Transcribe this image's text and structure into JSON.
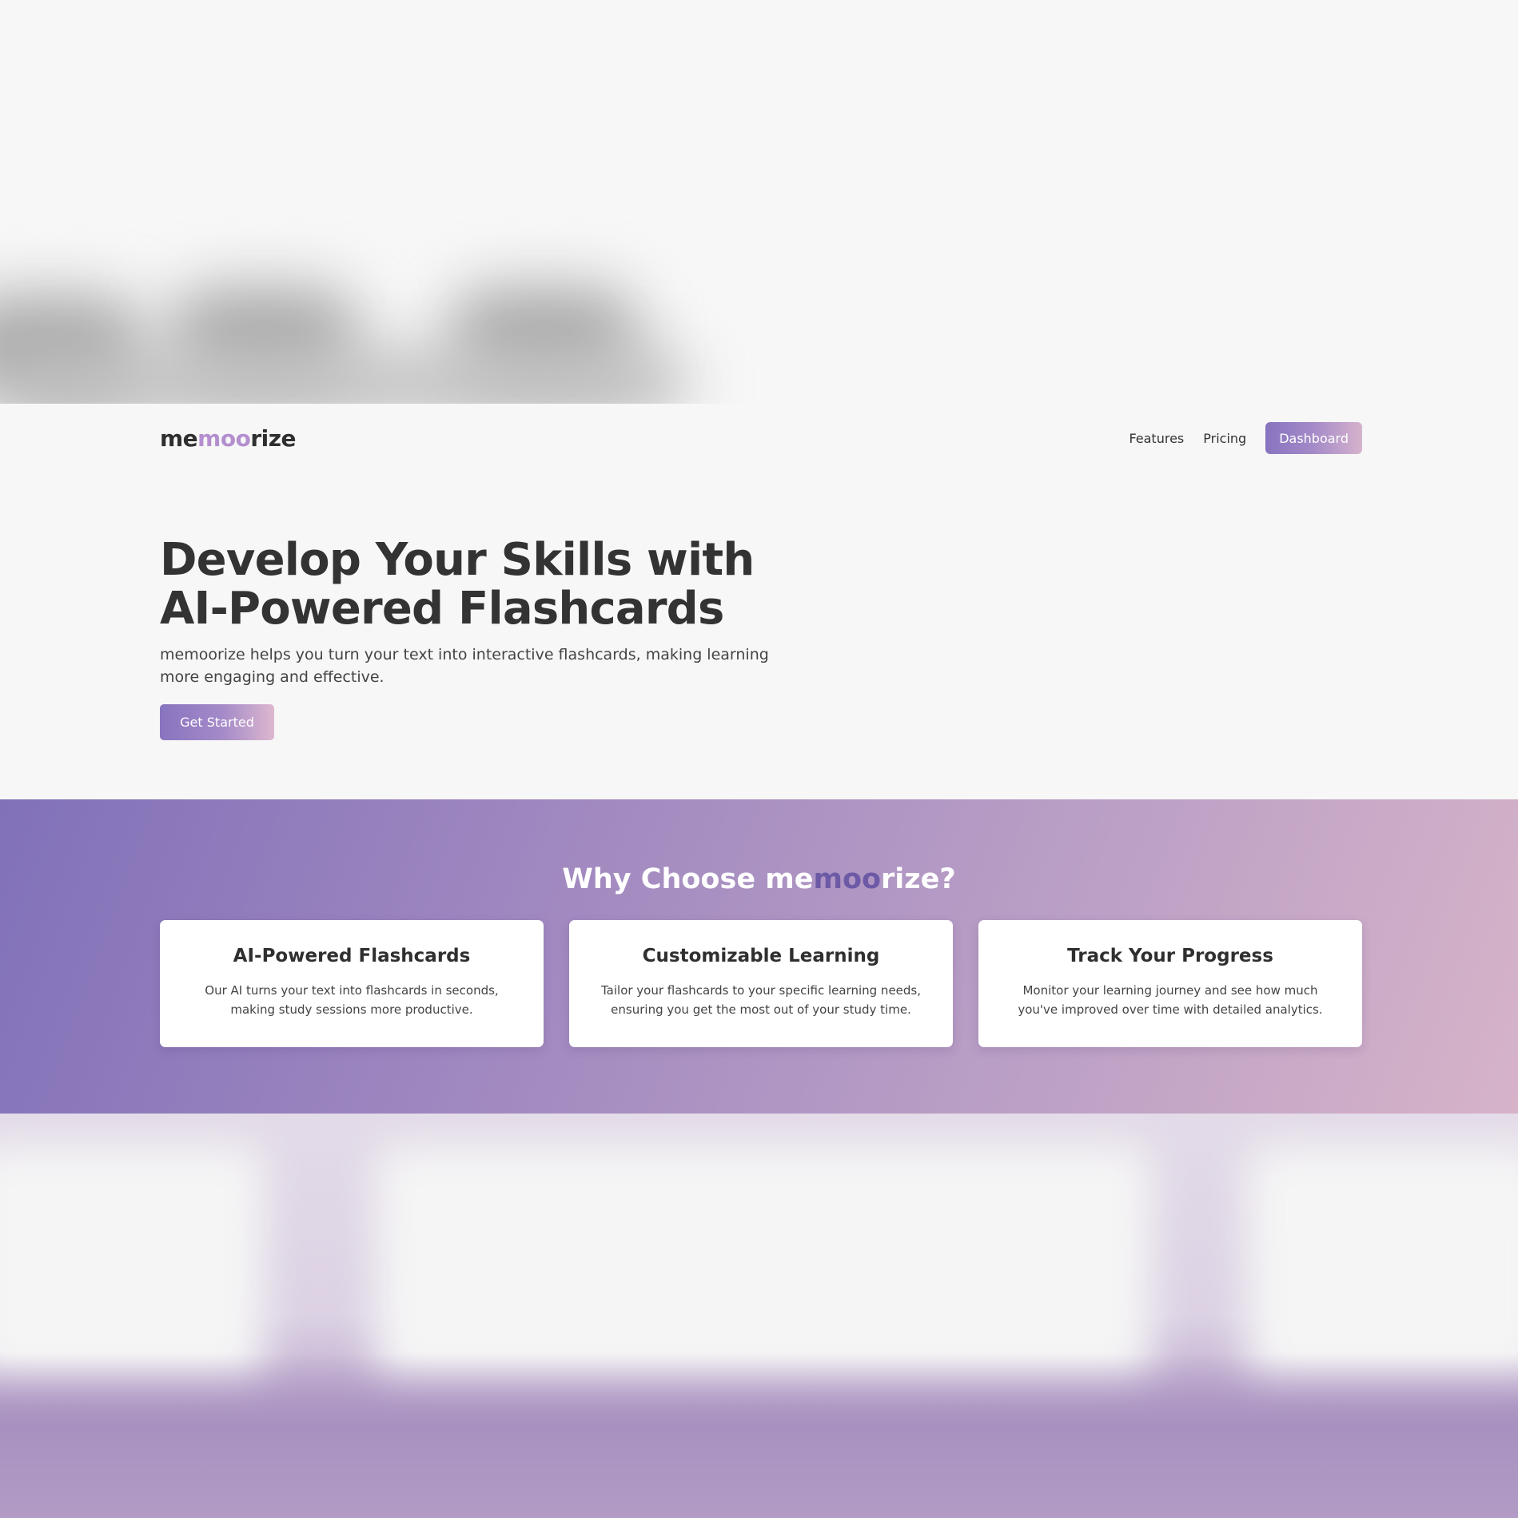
{
  "brand": {
    "logo_prefix": "me",
    "logo_middle": "moo",
    "logo_suffix": "rize"
  },
  "nav": {
    "features": "Features",
    "pricing": "Pricing",
    "dashboard": "Dashboard"
  },
  "hero": {
    "title_line1": "Develop Your Skills with",
    "title_line2": "AI-Powered Flashcards",
    "subtitle": "memoorize helps you turn your text into interactive flashcards, making learning more engaging and effective.",
    "cta": "Get Started"
  },
  "features": {
    "heading_prefix": "Why Choose ",
    "heading_brand_prefix": "me",
    "heading_brand_middle": "moo",
    "heading_brand_suffix": "rize",
    "heading_suffix": "?",
    "cards": [
      {
        "title": "AI-Powered Flashcards",
        "text": "Our AI turns your text into flashcards in seconds, making study sessions more productive."
      },
      {
        "title": "Customizable Learning",
        "text": "Tailor your flashcards to your specific learning needs, ensuring you get the most out of your study time."
      },
      {
        "title": "Track Your Progress",
        "text": "Monitor your learning journey and see how much you've improved over time with detailed analytics."
      }
    ]
  },
  "colors": {
    "accent": "#8874bf",
    "accent_light": "#d6b3cd",
    "logo_middle": "#b48fd0",
    "heading_brand_middle": "#6d5aa6",
    "text": "#333333",
    "background": "#f7f7f7"
  }
}
